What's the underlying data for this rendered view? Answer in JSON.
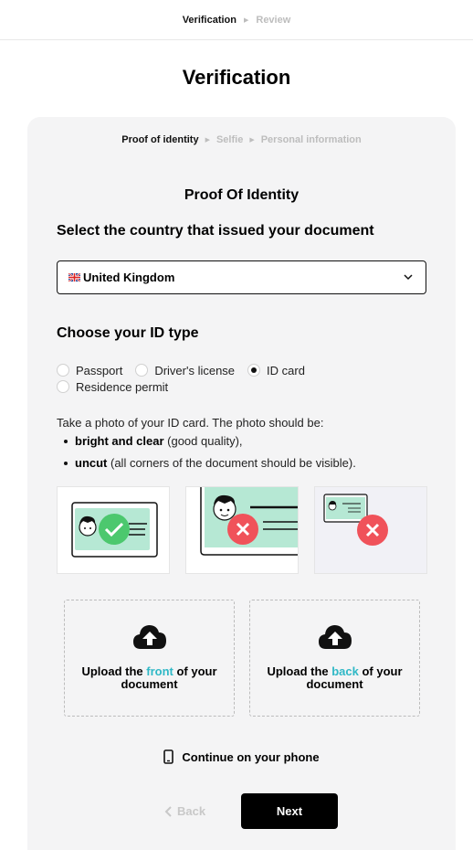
{
  "top_steps": {
    "step1": "Verification",
    "step2": "Review"
  },
  "page_title": "Verification",
  "sub_steps": {
    "step1": "Proof of identity",
    "step2": "Selfie",
    "step3": "Personal information"
  },
  "section_title": "Proof Of Identity",
  "country": {
    "label": "Select the country that issued your document",
    "selected": "United Kingdom"
  },
  "id_type": {
    "label": "Choose your ID type",
    "options": [
      "Passport",
      "Driver's license",
      "ID card",
      "Residence permit"
    ],
    "selected": "ID card"
  },
  "instructions": {
    "intro": "Take a photo of your ID card. The photo should be:",
    "item1_bold": "bright and clear",
    "item1_rest": " (good quality),",
    "item2_bold": "uncut",
    "item2_rest": " (all corners of the document should be visible)."
  },
  "samples": [
    {
      "status": "good",
      "icon": "check-icon"
    },
    {
      "status": "cut",
      "icon": "cross-icon"
    },
    {
      "status": "blurry",
      "icon": "cross-icon"
    }
  ],
  "upload_front": {
    "pre": "Upload the ",
    "hl": "front",
    "post": " of your document"
  },
  "upload_back": {
    "pre": "Upload the ",
    "hl": "back",
    "post": " of your document"
  },
  "phone_link": "Continue on your phone",
  "nav": {
    "back": "Back",
    "next": "Next"
  },
  "colors": {
    "accent": "#2fb8c6",
    "good": "#4cc86e",
    "bad": "#f0525a",
    "card_mint": "#b6e8d4"
  }
}
